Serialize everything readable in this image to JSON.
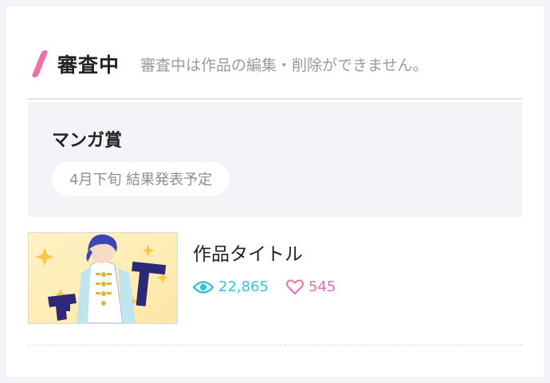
{
  "section": {
    "title": "審査中",
    "note": "審査中は作品の編集・削除ができません。"
  },
  "award": {
    "name": "マンガ賞",
    "schedule": "4月下旬 結果発表予定"
  },
  "work": {
    "title": "作品タイトル",
    "views": "22,865",
    "likes": "545",
    "thumbnail_icon": "manga-cover-thumbnail"
  },
  "colors": {
    "accent_pink": "#ef6fa6",
    "views_cyan": "#37c3e0",
    "panel_bg": "#f3f3f8"
  }
}
